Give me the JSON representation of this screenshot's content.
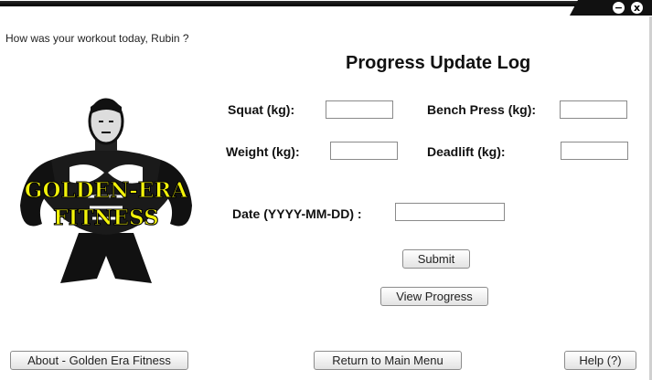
{
  "window": {
    "minimize_glyph": "−",
    "close_glyph": "x"
  },
  "greeting": "How was your workout today,  Rubin ?",
  "title": "Progress Update Log",
  "logo": {
    "line1": "GOLDEN-ERA",
    "line2": "FITNESS",
    "text_color": "#f2f20a"
  },
  "form": {
    "squat_label": "Squat (kg):",
    "bench_label": "Bench Press (kg):",
    "weight_label": "Weight (kg):",
    "deadlift_label": "Deadlift (kg):",
    "date_label": "Date (YYYY-MM-DD) :",
    "squat_value": "",
    "bench_value": "",
    "weight_value": "",
    "deadlift_value": "",
    "date_value": ""
  },
  "buttons": {
    "submit": "Submit",
    "view_progress": "View Progress",
    "about": "About - Golden Era Fitness",
    "main_menu": "Return to Main Menu",
    "help": "Help (?)"
  }
}
